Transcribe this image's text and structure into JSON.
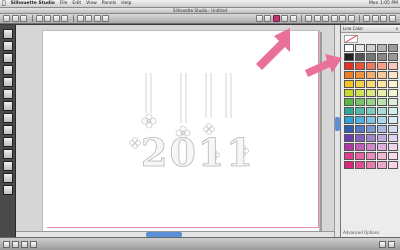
{
  "menubar": {
    "apple": "",
    "app_name": "Silhouette Studio",
    "items": [
      "File",
      "Edit",
      "View",
      "Panels",
      "Help"
    ],
    "clock": "Mon 1:05 PM"
  },
  "window": {
    "title": "Silhouette Studio - Untitled"
  },
  "design": {
    "year_text": "2011"
  },
  "panel": {
    "title": "Line Color",
    "close": "x",
    "footer": "Advanced Options",
    "swatch_colors": [
      "#ffffff",
      "#e8e8e8",
      "#cfcfcf",
      "#b5b5b5",
      "#9b9b9b",
      "#222222",
      "#555555",
      "#777777",
      "#888888",
      "#999999",
      "#e53320",
      "#e8553a",
      "#f07a5c",
      "#f4a08a",
      "#f8c7bb",
      "#f07c1f",
      "#f39440",
      "#f6ae6a",
      "#f8c898",
      "#fbe1c7",
      "#f6c21d",
      "#f8cf48",
      "#fadc77",
      "#fbe7a5",
      "#fdf3d2",
      "#c9d82d",
      "#d4e055",
      "#dfe880",
      "#e9f0aa",
      "#f4f7d5",
      "#58b947",
      "#76c667",
      "#97d48a",
      "#b8e2ae",
      "#dbf0d6",
      "#2fa89a",
      "#55b8ac",
      "#7ecabf",
      "#a9dcd5",
      "#d4eeea",
      "#2aa2d8",
      "#52b3df",
      "#7dc6e7",
      "#a8d9ef",
      "#d4ecf7",
      "#2f5fb3",
      "#5479c2",
      "#7e98d1",
      "#a8b8e0",
      "#d3dcf0",
      "#6a3fb0",
      "#8461bf",
      "#a185cf",
      "#c0aadf",
      "#e0d5ef",
      "#b03aa8",
      "#c05fba",
      "#d086cc",
      "#e0aede",
      "#efd6ee",
      "#e03c8a",
      "#e662a2",
      "#ec8cba",
      "#f2b5d2",
      "#f9dae9",
      "#d9257a",
      "#e04f94",
      "#e87caf",
      "#efa8c9",
      "#f7d3e4"
    ]
  },
  "accent": {
    "highlight": "#c2366e",
    "arrow": "#e8709a",
    "scroll_thumb": "#5a8fd6",
    "cut_line": "#e58fa3"
  }
}
